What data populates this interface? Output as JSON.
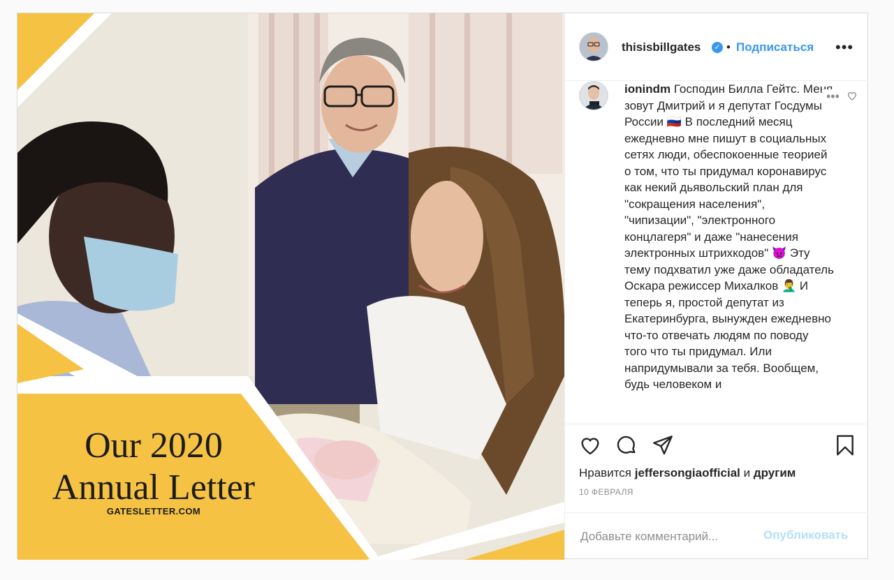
{
  "post": {
    "author": "thisisbillgates",
    "follow_label": "Подписаться",
    "dot": "•",
    "more_label": "•••",
    "verified_mark": "✓"
  },
  "media": {
    "title": "Our 2020 Annual Letter",
    "title_line1": "Our 2020",
    "title_line2": "Annual Letter",
    "url": "GATESLETTER.COM",
    "accent_color": "#f5c244"
  },
  "comment": {
    "username": "ionindm",
    "text": "Господин Билла Гейтс. Меня зовут Дмитрий и я депутат Госдумы России 🇷🇺 В последний месяц ежедневно мне пишут в социальных сетях люди, обеспокоенные теорией о том, что ты придумал коронавирус как некий дьявольский план для \"сокращения населения\", \"чипизации\", \"электронного концлагеря\" и даже \"нанесения электронных штрихкодов\" 👿 Эту тему подхватил уже даже обладатель Оскара режиссер Михалков 🤦‍♂️ И теперь я, простой депутат из Екатеринбурга, вынужден ежедневно что-то отвечать людям по поводу того что ты придумал. Или напридумывали за тебя. Вообщем, будь человеком и",
    "more_label": "•••"
  },
  "actions": {
    "likes_prefix": "Нравится",
    "likes_user": "jeffersongiaofficial",
    "likes_and": "и",
    "likes_others": "другим",
    "date": "10 ФЕВРАЛЯ"
  },
  "add_comment": {
    "placeholder": "Добавьте комментарий...",
    "publish_label": "Опубликовать"
  },
  "colors": {
    "link": "#3897f0",
    "muted": "#8e8e8e",
    "publish_disabled": "#b2dffc",
    "border": "#dbdbdb"
  }
}
